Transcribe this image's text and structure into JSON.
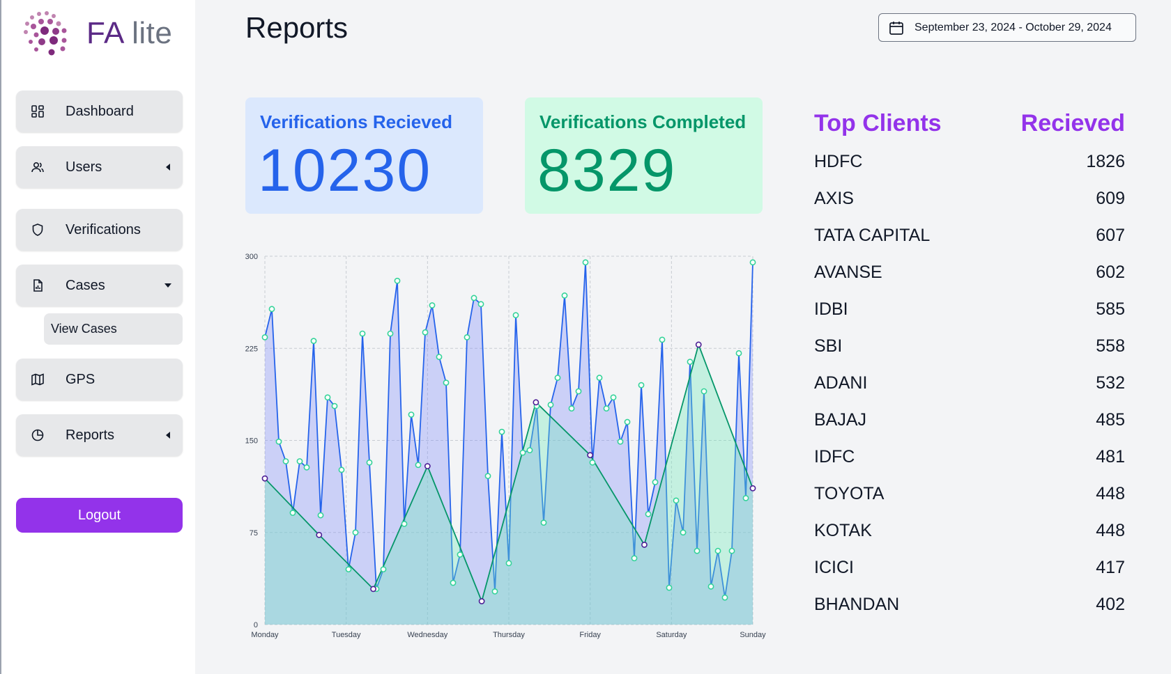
{
  "app": {
    "logo_fa": "FA",
    "logo_lite": "lite"
  },
  "sidebar": {
    "items": [
      {
        "label": "Dashboard",
        "icon": "dashboard-icon"
      },
      {
        "label": "Users",
        "icon": "users-icon"
      },
      {
        "label": "Verifications",
        "icon": "shield-icon"
      },
      {
        "label": "Cases",
        "icon": "file-chart-icon"
      },
      {
        "label": "GPS",
        "icon": "map-icon"
      },
      {
        "label": "Reports",
        "icon": "pie-chart-icon"
      }
    ],
    "sub_item": "View Cases",
    "logout": "Logout"
  },
  "header": {
    "title": "Reports",
    "date_range": "September 23, 2024 - October 29, 2024"
  },
  "cards": {
    "received": {
      "title": "Verifications Recieved",
      "value": "10230"
    },
    "completed": {
      "title": "Verifications Completed",
      "value": "8329"
    }
  },
  "clients": {
    "header_name": "Top Clients",
    "header_count": "Recieved",
    "rows": [
      {
        "name": "HDFC",
        "count": "1826"
      },
      {
        "name": "AXIS",
        "count": "609"
      },
      {
        "name": "TATA CAPITAL",
        "count": "607"
      },
      {
        "name": "AVANSE",
        "count": "602"
      },
      {
        "name": "IDBI",
        "count": "585"
      },
      {
        "name": "SBI",
        "count": "558"
      },
      {
        "name": "ADANI",
        "count": "532"
      },
      {
        "name": "BAJAJ",
        "count": "485"
      },
      {
        "name": "IDFC",
        "count": "481"
      },
      {
        "name": "TOYOTA",
        "count": "448"
      },
      {
        "name": "KOTAK",
        "count": "448"
      },
      {
        "name": "ICICI",
        "count": "417"
      },
      {
        "name": "BHANDAN",
        "count": "402"
      }
    ]
  },
  "colors": {
    "accent": "#9333ea",
    "blue": "#2563eb",
    "green": "#059669"
  },
  "chart_data": {
    "type": "area",
    "categories": [
      "Monday",
      "Tuesday",
      "Wednesday",
      "Thursday",
      "Friday",
      "Saturday",
      "Sunday"
    ],
    "ylim": [
      0,
      300
    ],
    "yticks": [
      0,
      75,
      150,
      225,
      300
    ],
    "grid": true,
    "series": [
      {
        "color": "#2563eb",
        "point_color": "#34d399",
        "values": [
          234,
          257,
          149,
          133,
          91,
          133,
          128,
          231,
          89,
          185,
          178,
          126,
          45,
          75,
          237,
          132,
          29,
          45,
          237,
          280,
          82,
          171,
          130,
          238,
          260,
          218,
          197,
          34,
          57,
          234,
          266,
          261,
          121,
          27,
          157,
          50,
          252,
          140,
          142,
          178,
          83,
          179,
          201,
          268,
          176,
          190,
          295,
          132,
          201,
          176,
          185,
          149,
          165,
          54,
          195,
          90,
          116,
          232,
          30,
          101,
          75,
          214,
          60,
          190,
          31,
          60,
          22,
          60,
          221,
          103,
          295
        ]
      },
      {
        "color": "#059669",
        "point_color": "#4c1d95",
        "values": [
          119,
          73,
          29,
          129,
          19,
          181,
          138,
          65,
          228,
          111
        ]
      }
    ]
  }
}
